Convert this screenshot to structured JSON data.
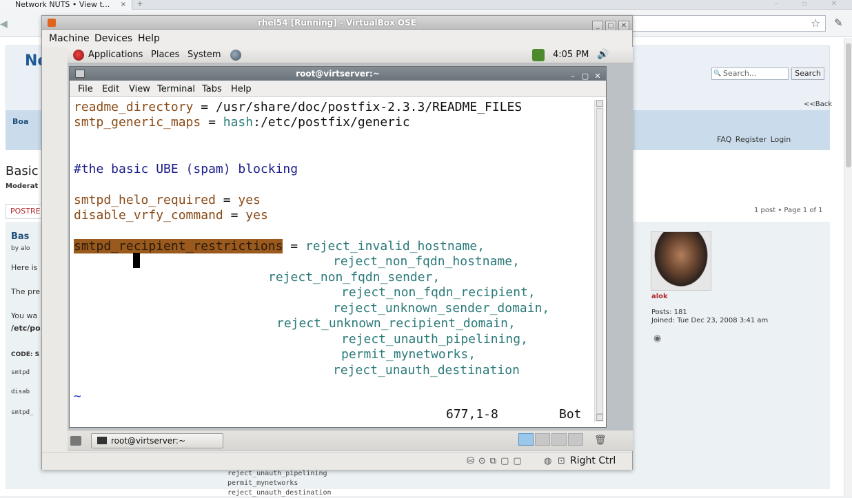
{
  "browser": {
    "tab_title": "Network NUTS • View t...",
    "tab_close": "×",
    "new_tab": "+"
  },
  "forum": {
    "logo": "Ne",
    "search_placeholder": "Search...",
    "search_button": "Search",
    "back_link": "<<Back",
    "board_link": "Boa",
    "nav_links": "FAQ  Register  Login",
    "topic_title": "Basic",
    "moderator": "Moderat",
    "post_reply": "POSTRE",
    "pagination": "1 post • Page 1 of 1",
    "post_title": "Bas",
    "post_by": "by alo",
    "post_lines": [
      "Here is",
      "The pre",
      "You wa",
      "/etc/po",
      "CODE: S",
      "smtpd",
      "disab",
      "smtpd_"
    ],
    "username": "alok",
    "posts_label": "Posts: 181",
    "joined_label": "Joined: Tue Dec 23, 2008 3:41 am",
    "code_tail": [
      "reject_unauth_pipelining",
      "permit_mynetworks",
      "reject_unauth_destination"
    ]
  },
  "vbox": {
    "title": "rhel54 [Running] - VirtualBox OSE",
    "menu": [
      "Machine",
      "Devices",
      "Help"
    ],
    "host_key": "Right Ctrl"
  },
  "gnome": {
    "menus": [
      "Applications",
      "Places",
      "System"
    ],
    "clock": "4:05 PM",
    "taskbar_item": "root@virtserver:~"
  },
  "terminal": {
    "title": "root@virtserver:~",
    "menu": [
      "File",
      "Edit",
      "View",
      "Terminal",
      "Tabs",
      "Help"
    ]
  },
  "vim": {
    "line1_key": "readme_directory",
    "line1_rest": " = /usr/share/doc/postfix-2.3.3/README_FILES",
    "line2_key": "smtp_generic_maps",
    "line2_eq": " = ",
    "line2_val": "hash",
    "line2_rest": ":/etc/postfix/generic",
    "comment": "#the basic UBE (spam) blocking",
    "helo_key": "smtpd_helo_required",
    "helo_eq": " = ",
    "helo_val": "yes",
    "vrfy_key": "disable_vrfy_command",
    "vrfy_eq": " = ",
    "vrfy_val": "yes",
    "restr_key": "smtpd_recipient_restrictions",
    "restr_eq": " = ",
    "restr_values": [
      "reject_invalid_hostname,",
      "reject_non_fqdn_hostname,",
      "reject_non_fqdn_sender,",
      "reject_non_fqdn_recipient,",
      "reject_unknown_sender_domain,",
      "reject_unknown_recipient_domain,",
      "reject_unauth_pipelining,",
      "permit_mynetworks,",
      "reject_unauth_destination"
    ],
    "tilde": "~",
    "position": "677,1-8",
    "scroll_pos": "Bot"
  },
  "colors": {
    "keyword": "#8a4a16",
    "value": "#2c7a7a",
    "highlight": "#9a5a1d",
    "comment": "#1c1c8c"
  }
}
